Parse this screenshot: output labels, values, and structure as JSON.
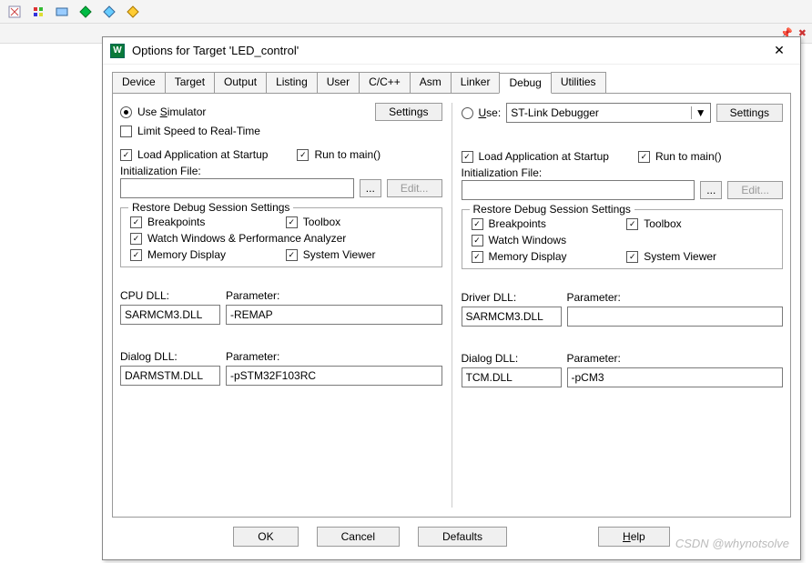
{
  "window": {
    "title": "Options for Target 'LED_control'"
  },
  "tabs": [
    "Device",
    "Target",
    "Output",
    "Listing",
    "User",
    "C/C++",
    "Asm",
    "Linker",
    "Debug",
    "Utilities"
  ],
  "activeTab": "Debug",
  "left": {
    "useSimulator": "Use Simulator",
    "settingsBtn": "Settings",
    "limitSpeed": "Limit Speed to Real-Time",
    "loadApp": "Load Application at Startup",
    "runMain": "Run to main()",
    "initFileLabel": "Initialization File:",
    "initFile": "",
    "browseBtn": "...",
    "editBtn": "Edit...",
    "restoreTitle": "Restore Debug Session Settings",
    "breakpoints": "Breakpoints",
    "toolbox": "Toolbox",
    "watch": "Watch Windows & Performance Analyzer",
    "memory": "Memory Display",
    "sysview": "System Viewer",
    "cpuDllLabel": "CPU DLL:",
    "cpuDll": "SARMCM3.DLL",
    "cpuParamLabel": "Parameter:",
    "cpuParam": "-REMAP",
    "dlgDllLabel": "Dialog DLL:",
    "dlgDll": "DARMSTM.DLL",
    "dlgParamLabel": "Parameter:",
    "dlgParam": "-pSTM32F103RC"
  },
  "right": {
    "useLabel": "Use:",
    "debugger": "ST-Link Debugger",
    "settingsBtn": "Settings",
    "loadApp": "Load Application at Startup",
    "runMain": "Run to main()",
    "initFileLabel": "Initialization File:",
    "initFile": "",
    "browseBtn": "...",
    "editBtn": "Edit...",
    "restoreTitle": "Restore Debug Session Settings",
    "breakpoints": "Breakpoints",
    "toolbox": "Toolbox",
    "watch": "Watch Windows",
    "memory": "Memory Display",
    "sysview": "System Viewer",
    "drvDllLabel": "Driver DLL:",
    "drvDll": "SARMCM3.DLL",
    "drvParamLabel": "Parameter:",
    "drvParam": "",
    "dlgDllLabel": "Dialog DLL:",
    "dlgDll": "TCM.DLL",
    "dlgParamLabel": "Parameter:",
    "dlgParam": "-pCM3"
  },
  "buttons": {
    "ok": "OK",
    "cancel": "Cancel",
    "defaults": "Defaults",
    "help": "Help"
  },
  "watermark": "CSDN @whynotsolve"
}
